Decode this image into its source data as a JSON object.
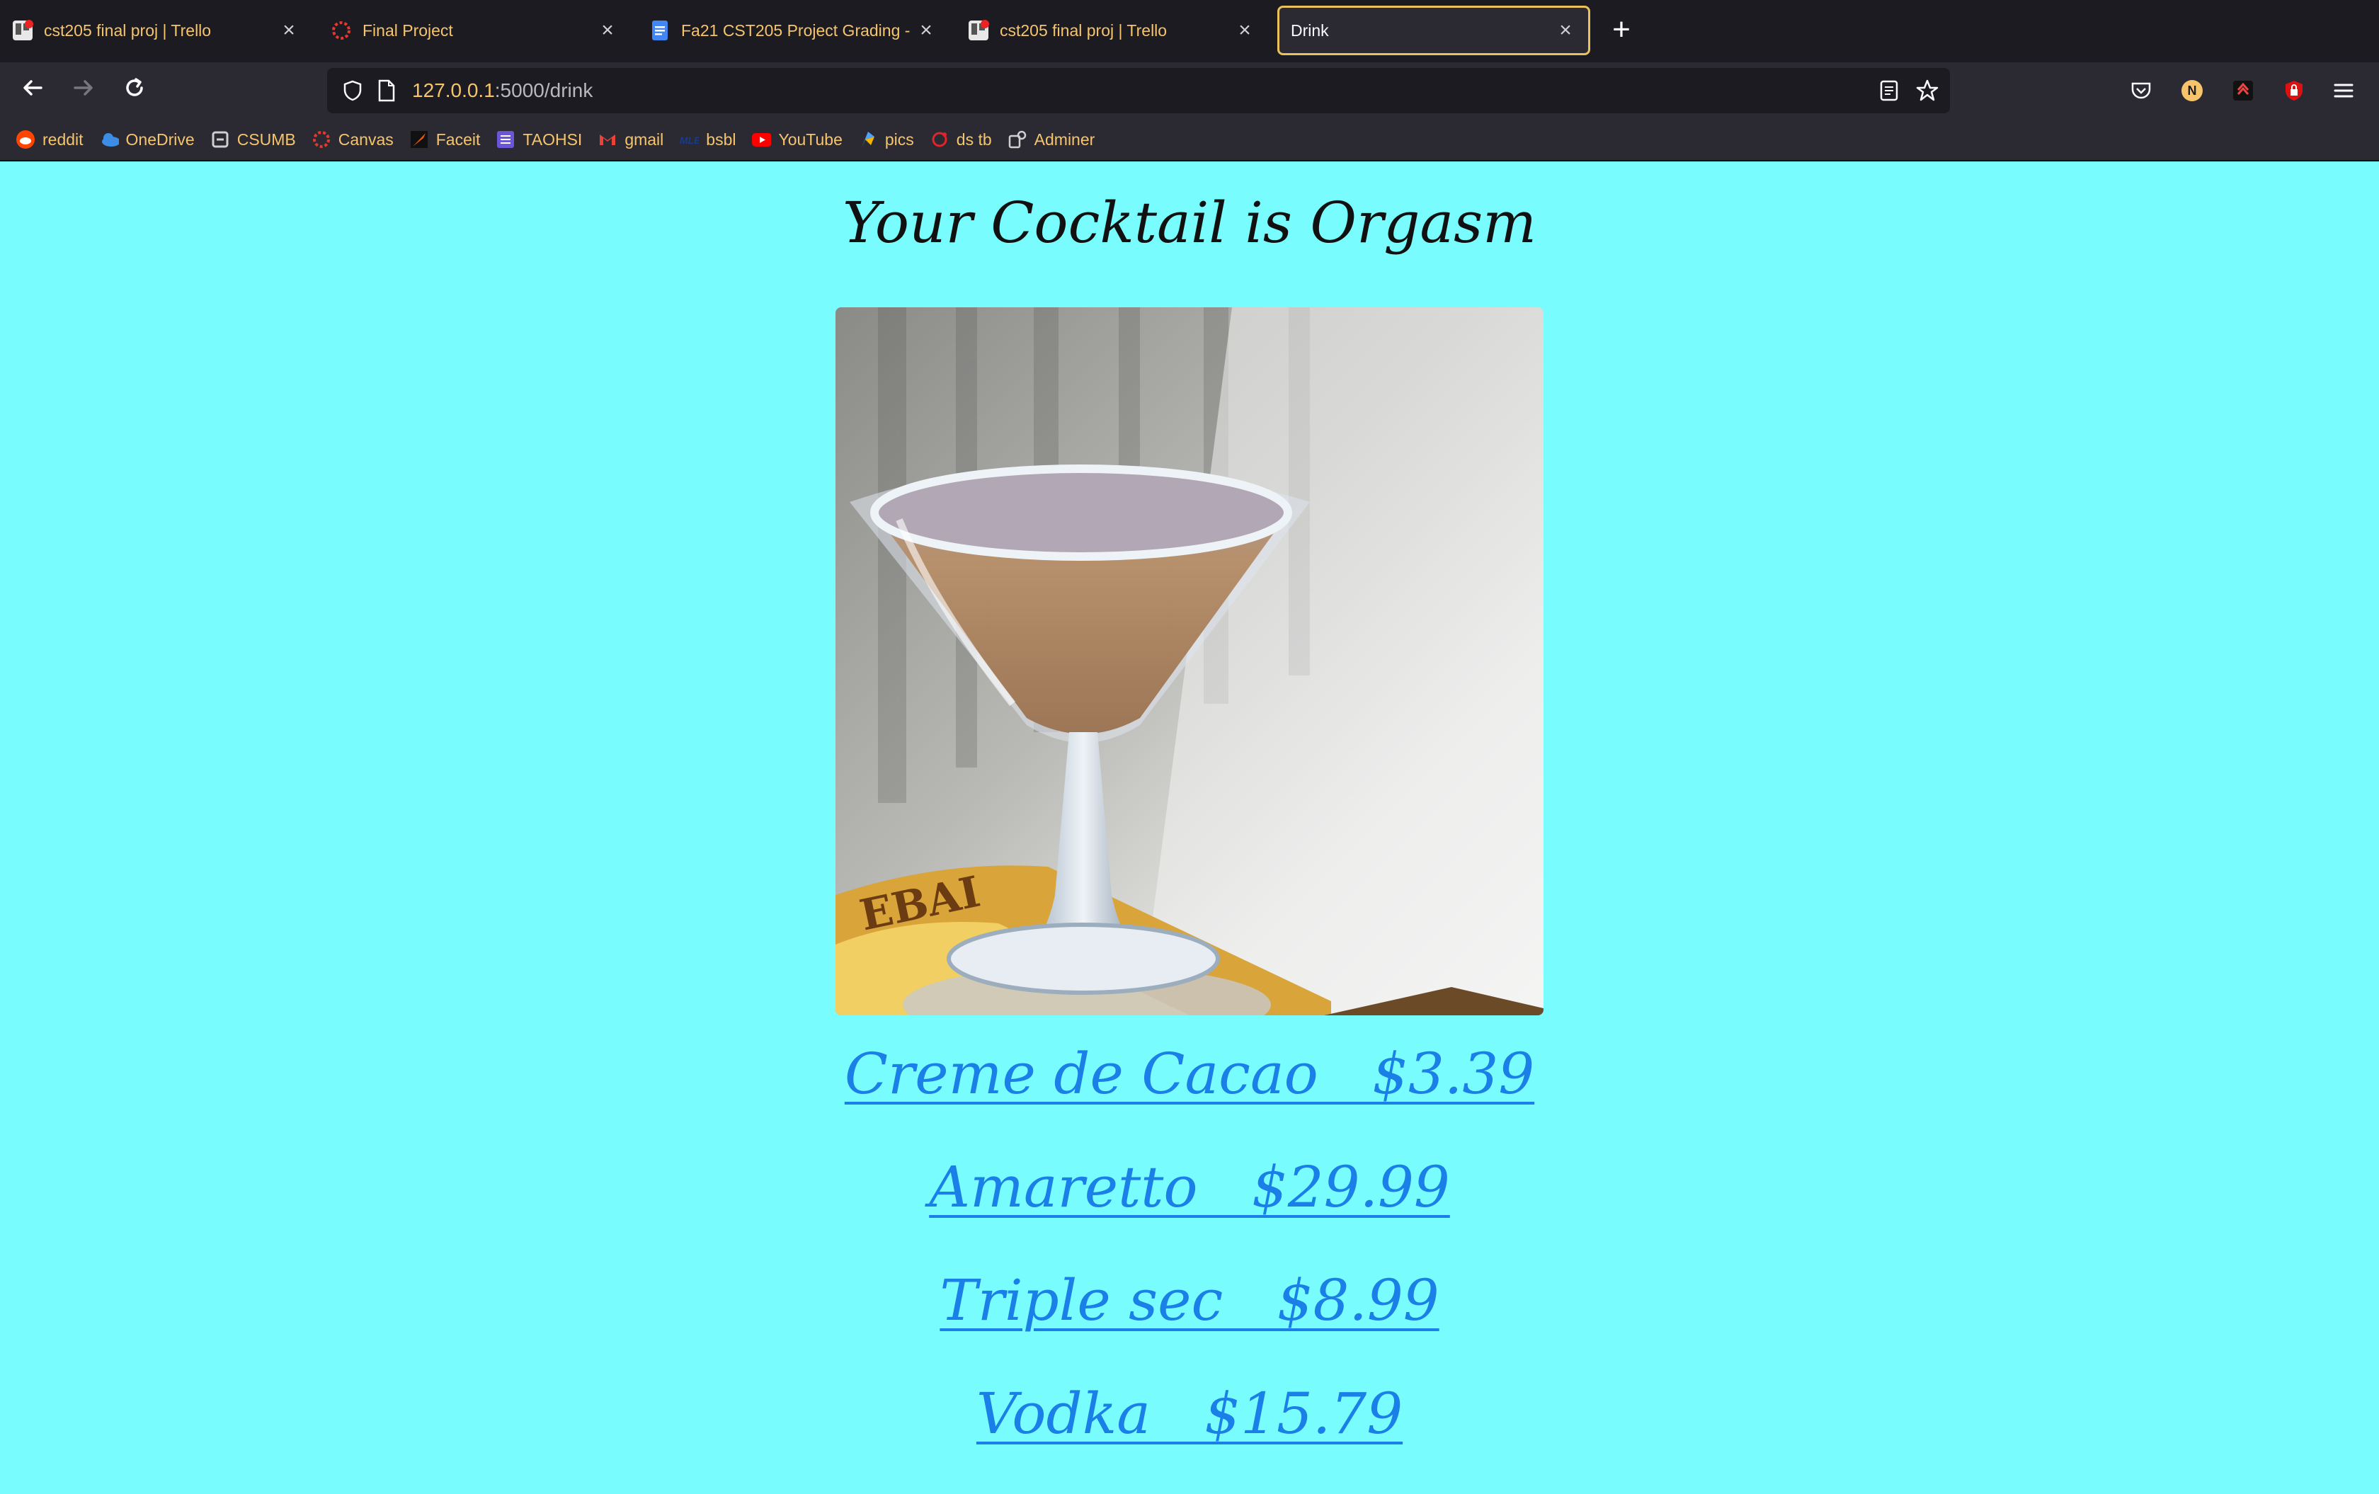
{
  "tabs": [
    {
      "title": "cst205 final proj | Trello",
      "icon": "trello-icon"
    },
    {
      "title": "Final Project",
      "icon": "canvas-icon"
    },
    {
      "title": "Fa21 CST205 Project Grading -",
      "icon": "google-docs-icon"
    },
    {
      "title": "cst205 final proj | Trello",
      "icon": "trello-icon"
    },
    {
      "title": "Drink",
      "icon": "none",
      "active": true
    }
  ],
  "urlbar": {
    "host": "127.0.0.1",
    "path": ":5000/drink"
  },
  "bookmarks": [
    {
      "label": "reddit",
      "icon": "reddit-icon",
      "color": "#ff4500"
    },
    {
      "label": "OneDrive",
      "icon": "onedrive-icon",
      "color": "#3b8de6"
    },
    {
      "label": "CSUMB",
      "icon": "csumb-icon",
      "color": "#cfcfcf"
    },
    {
      "label": "Canvas",
      "icon": "canvas-icon",
      "color": "#e4392e"
    },
    {
      "label": "Faceit",
      "icon": "faceit-icon",
      "color": "#ff5500"
    },
    {
      "label": "TAOHSI",
      "icon": "taohsi-icon",
      "color": "#6b55d9"
    },
    {
      "label": "gmail",
      "icon": "gmail-icon",
      "color": "#ea4335"
    },
    {
      "label": "bsbl",
      "icon": "bsbl-icon",
      "color": "#1a3a8a"
    },
    {
      "label": "YouTube",
      "icon": "youtube-icon",
      "color": "#ff0000"
    },
    {
      "label": "pics",
      "icon": "pics-icon",
      "color": "#4fa3f7"
    },
    {
      "label": "ds tb",
      "icon": "dstb-icon",
      "color": "#e0242b"
    },
    {
      "label": "Adminer",
      "icon": "adminer-icon",
      "color": "#cfcfcf"
    }
  ],
  "page": {
    "title": "Your Cocktail is Orgasm",
    "ingredients": [
      {
        "label": "Creme de Cacao   $3.39"
      },
      {
        "label": "Amaretto   $29.99"
      },
      {
        "label": "Triple sec   $8.99"
      },
      {
        "label": "Vodka   $15.79"
      }
    ]
  },
  "colors": {
    "page_background": "#78fcfe",
    "link": "#1a7fe6",
    "accent": "#f6c56b"
  }
}
